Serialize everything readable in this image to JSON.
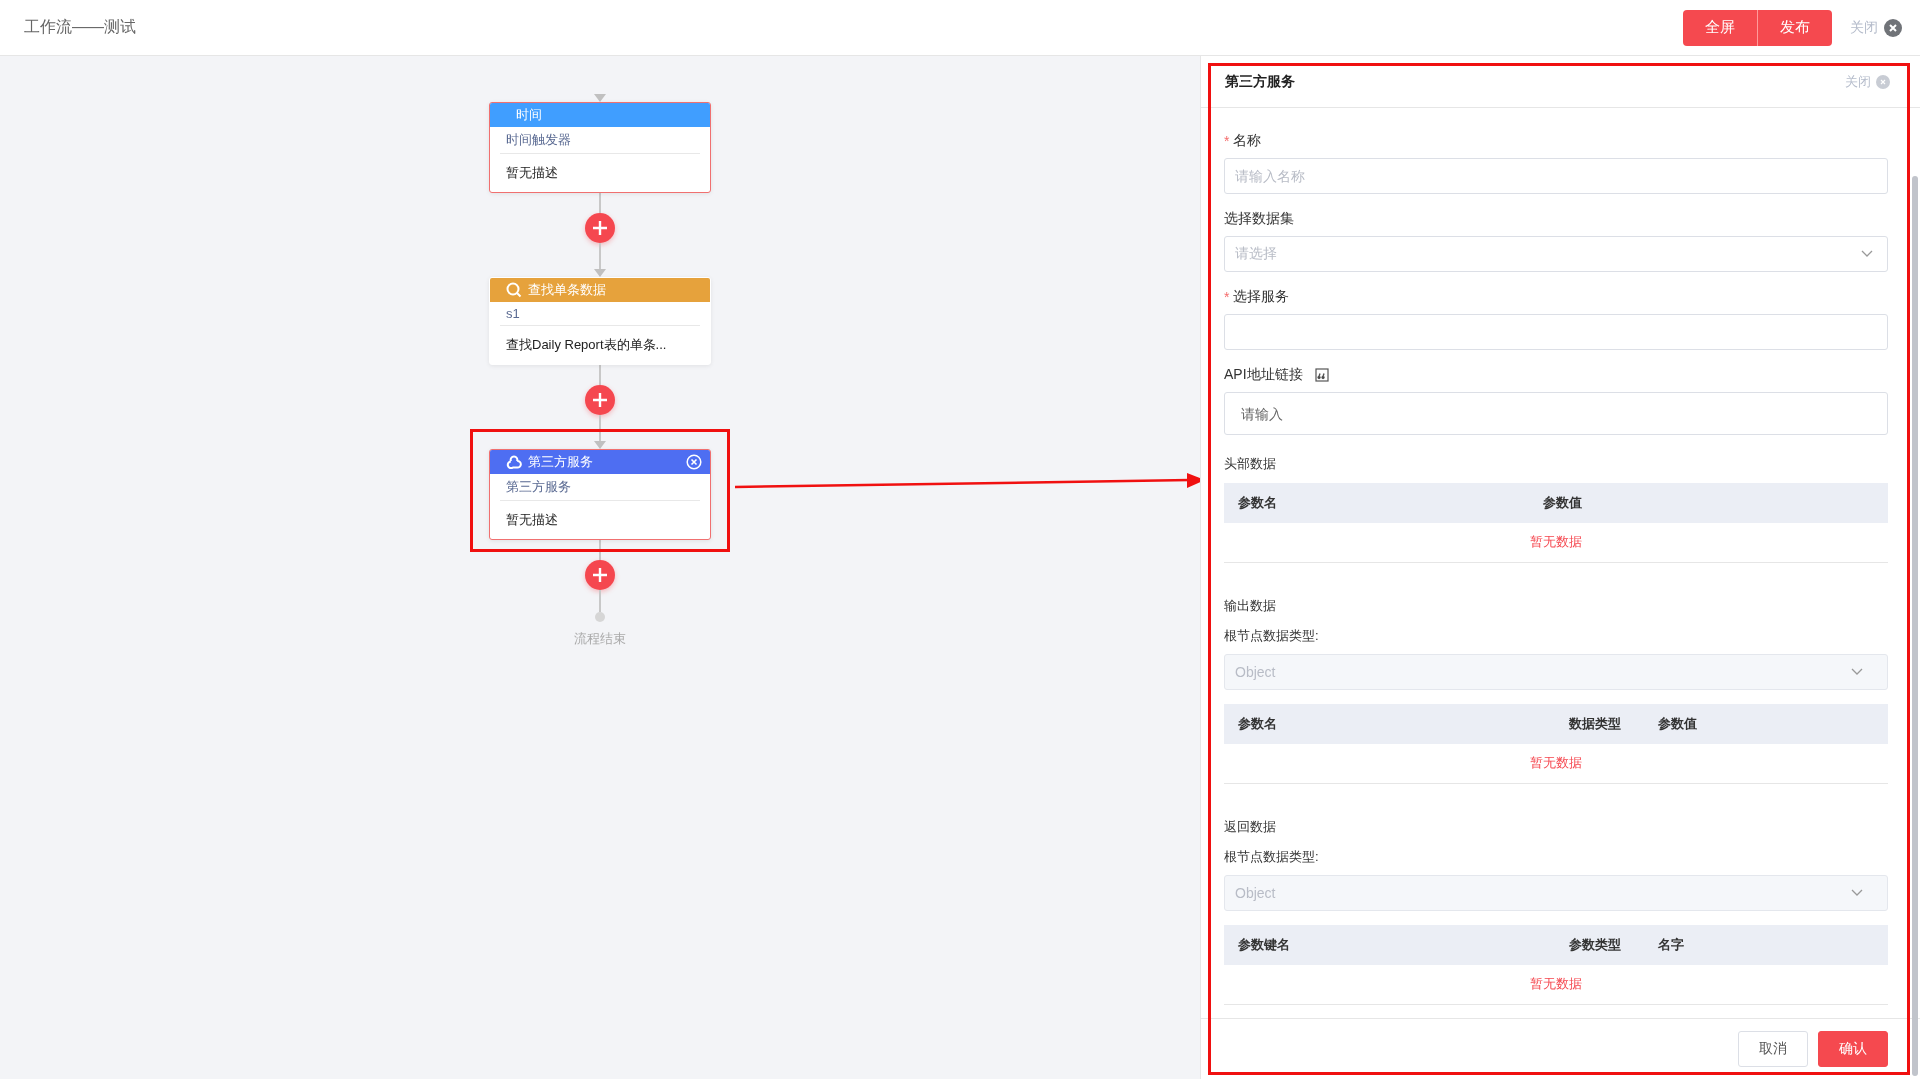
{
  "header": {
    "title": "工作流——测试",
    "buttons": [
      "全屏",
      "发布"
    ],
    "close": "关闭"
  },
  "flow": {
    "nodes": [
      {
        "kind": "trigger",
        "color": "#409eff",
        "title": "时间",
        "name": "时间触发器",
        "description": "暂无描述",
        "flagged": true,
        "selected": false
      },
      {
        "kind": "query",
        "color": "#e6a23c",
        "title": "查找单条数据",
        "name": "s1",
        "description": "查找Daily Report表的单条...",
        "flagged": false,
        "selected": false
      },
      {
        "kind": "service",
        "color": "#4e6ef2",
        "title": "第三方服务",
        "name": "第三方服务",
        "description": "暂无描述",
        "flagged": true,
        "selected": true
      }
    ],
    "end_label": "流程结束"
  },
  "panel": {
    "title": "第三方服务",
    "close": "关闭",
    "highlighted": true,
    "fields": [
      {
        "kind": "input",
        "label": "名称",
        "required_mark": "*",
        "placeholder": "请输入名称"
      },
      {
        "kind": "select",
        "label": "选择数据集",
        "placeholder": "请选择"
      },
      {
        "kind": "input",
        "label": "选择服务",
        "required_mark": "*"
      },
      {
        "kind": "api",
        "label": "API地址链接",
        "placeholder": "请输入"
      }
    ],
    "sections": [
      {
        "title": "头部数据",
        "columns": [
          "参数名",
          "参数值"
        ],
        "empty_text": "暂无数据"
      },
      {
        "title": "输出数据",
        "type_label": "根节点数据类型:",
        "type_value": "Object",
        "columns": [
          "参数名",
          "数据类型",
          "参数值"
        ],
        "empty_text": "暂无数据"
      },
      {
        "title": "返回数据",
        "type_label": "根节点数据类型:",
        "type_value": "Object",
        "columns": [
          "参数键名",
          "参数类型",
          "名字"
        ],
        "empty_text": "暂无数据"
      }
    ],
    "buttons": [
      {
        "kind": "secondary",
        "label": "取消"
      },
      {
        "kind": "primary",
        "label": "确认"
      }
    ]
  }
}
